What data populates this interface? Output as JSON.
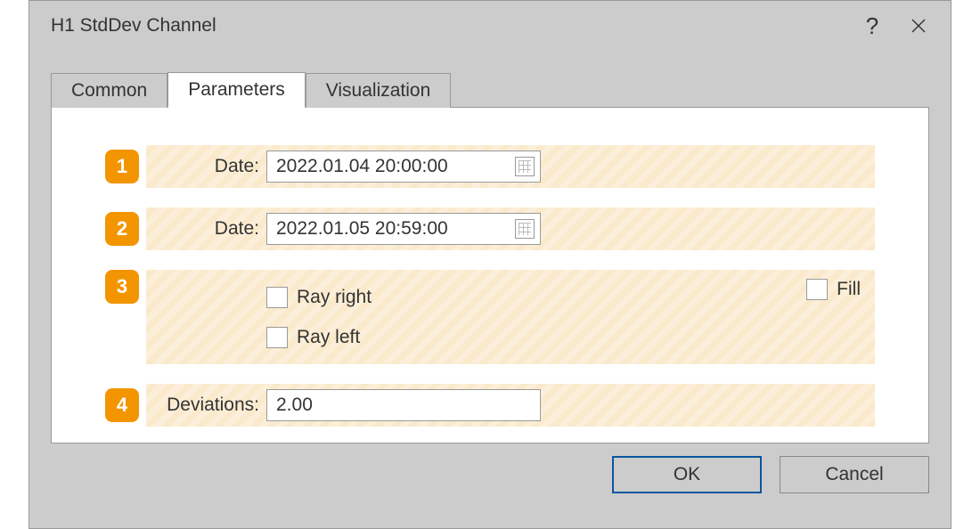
{
  "dialog": {
    "title": "H1 StdDev Channel"
  },
  "tabs": {
    "common": "Common",
    "parameters": "Parameters",
    "visualization": "Visualization"
  },
  "rows": {
    "r1": {
      "badge": "1",
      "label": "Date:",
      "value": "2022.01.04 20:00:00"
    },
    "r2": {
      "badge": "2",
      "label": "Date:",
      "value": "2022.01.05 20:59:00"
    },
    "r3": {
      "badge": "3",
      "ray_right": "Ray right",
      "ray_left": "Ray left",
      "fill": "Fill"
    },
    "r4": {
      "badge": "4",
      "label": "Deviations:",
      "value": "2.00"
    }
  },
  "buttons": {
    "ok": "OK",
    "cancel": "Cancel"
  }
}
